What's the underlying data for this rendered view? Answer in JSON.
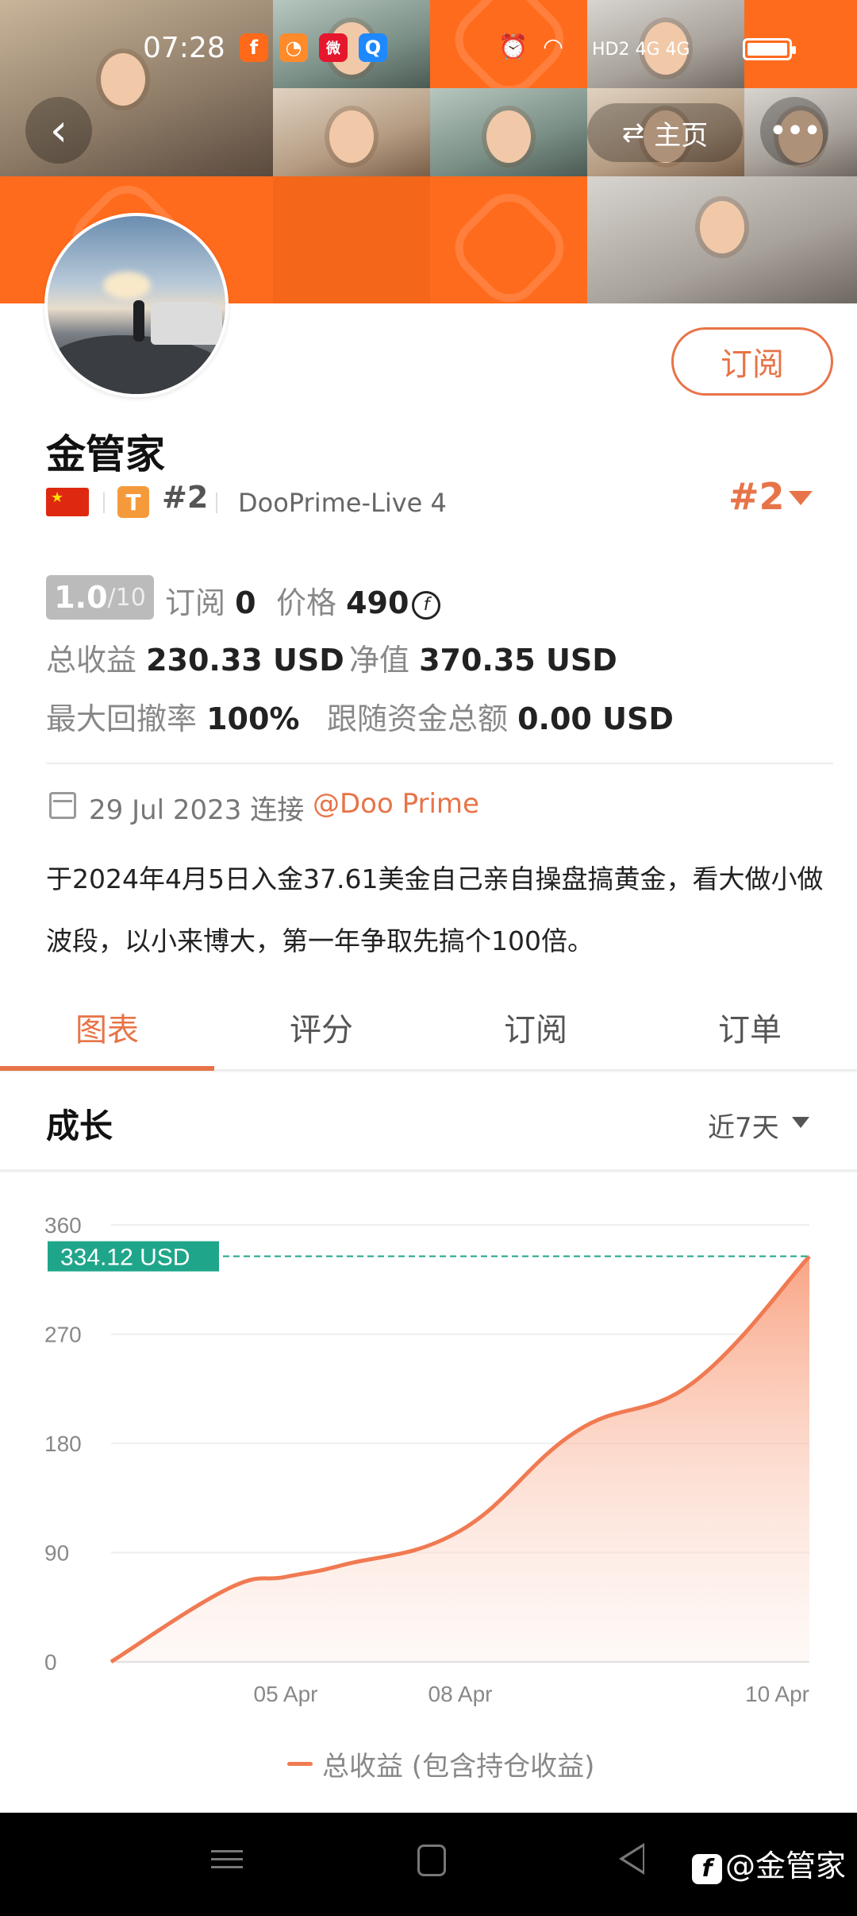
{
  "status_bar": {
    "time": "07:28",
    "app_icons": [
      "f",
      "◔",
      "微",
      "Q"
    ],
    "network": "HD2 4G 4G"
  },
  "header": {
    "back_icon": "chevron-left-icon",
    "home_label": "主页",
    "more_icon": "more-dots-icon"
  },
  "profile": {
    "subscribe_label": "订阅",
    "name": "金管家",
    "flag": "cn-flag",
    "badge": "T",
    "rank": "#2",
    "server": "DooPrime-Live 4",
    "rank_right": "#2"
  },
  "stats": {
    "score": "1.0",
    "score_max": "/10",
    "subscribers_label": "订阅",
    "subscribers": "0",
    "price_label": "价格",
    "price": "490",
    "coin_symbol": "f",
    "total_profit_label": "总收益",
    "total_profit": "230.33 USD",
    "net_value_label": "净值",
    "net_value": "370.35 USD",
    "max_drawdown_label": "最大回撤率",
    "max_drawdown": "100%",
    "follow_amount_label": "跟随资金总额",
    "follow_amount": "0.00 USD"
  },
  "info": {
    "joined": "29 Jul 2023 连接",
    "broker": "@Doo Prime",
    "bio": "于2024年4月5日入金37.61美金自己亲自操盘搞黄金，看大做小做波段，以小来博大，第一年争取先搞个100倍。"
  },
  "tabs": [
    {
      "label": "图表",
      "active": true
    },
    {
      "label": "评分",
      "active": false
    },
    {
      "label": "订阅",
      "active": false
    },
    {
      "label": "订单",
      "active": false
    }
  ],
  "growth": {
    "title": "成长",
    "range": "近7天"
  },
  "chart_data": {
    "type": "area",
    "title": "",
    "ylim": [
      0,
      360
    ],
    "yticks": [
      "0",
      "90",
      "180",
      "270",
      "360"
    ],
    "xticks": [
      "05 Apr",
      "08 Apr",
      "10 Apr"
    ],
    "x_tick_positions_index": [
      1.5,
      3.0,
      6.0
    ],
    "marker_label": "334.12 USD",
    "series": [
      {
        "name": "总收益 (包含持仓收益)",
        "x": [
          0,
          1,
          1.5,
          2,
          3,
          4,
          5,
          6
        ],
        "values": [
          0,
          60,
          70,
          80,
          108,
          190,
          230,
          334.12
        ]
      }
    ],
    "line_color": "#f07a52",
    "marker_color": "#1fa68a",
    "legend": "bottom-center"
  },
  "watermark": "@金管家"
}
